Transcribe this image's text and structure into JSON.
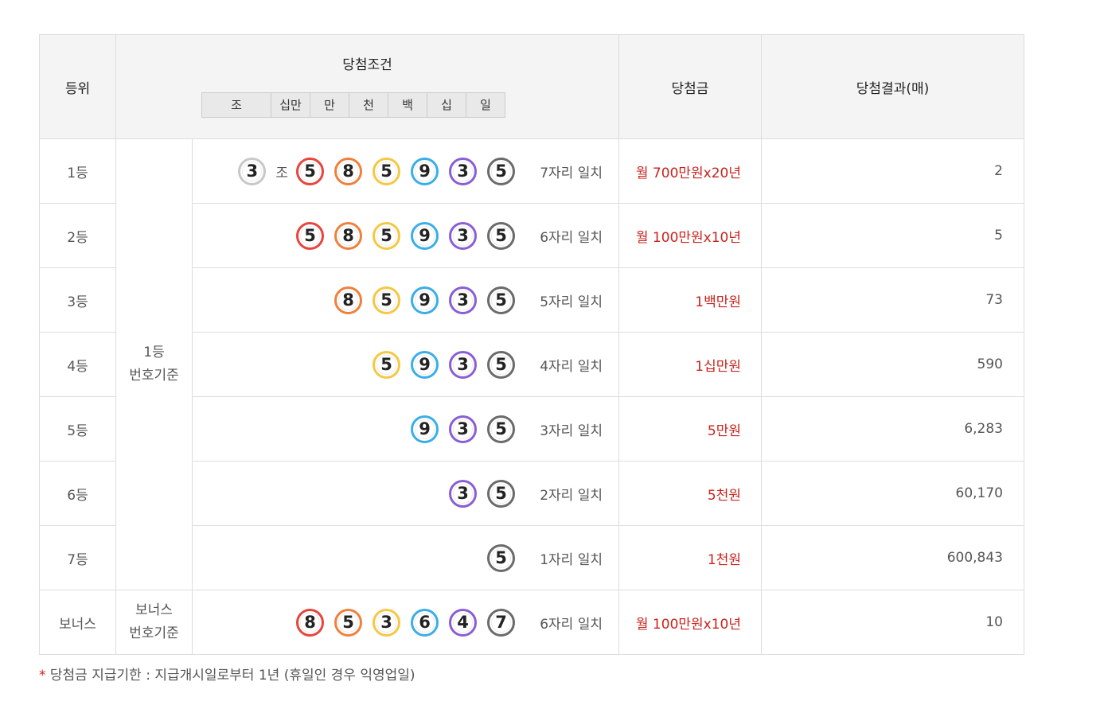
{
  "headers": {
    "rank": "등위",
    "condition": "당첨조건",
    "prize": "당첨금",
    "result": "당첨결과(매)"
  },
  "digit_headers": [
    "조",
    "십만",
    "만",
    "천",
    "백",
    "십",
    "일"
  ],
  "basis": {
    "main": [
      "1등",
      "번호기준"
    ],
    "bonus": [
      "보너스",
      "번호기준"
    ]
  },
  "jo_label": "조",
  "colors": {
    "ball_jo": "#c8c8c8",
    "ball_100k": "#e8453c",
    "ball_10k": "#f0803c",
    "ball_1k": "#f5c842",
    "ball_100": "#3aaee8",
    "ball_10": "#8a5ed6",
    "ball_1": "#6b6b6b",
    "prize_text": "#c9231d"
  },
  "rows": [
    {
      "rank": "1등",
      "jo": "3",
      "balls": [
        "5",
        "8",
        "5",
        "9",
        "3",
        "5"
      ],
      "match": "7자리 일치",
      "prize": "월 700만원x20년",
      "result": "2"
    },
    {
      "rank": "2등",
      "balls": [
        "5",
        "8",
        "5",
        "9",
        "3",
        "5"
      ],
      "match": "6자리 일치",
      "prize": "월 100만원x10년",
      "result": "5"
    },
    {
      "rank": "3등",
      "balls": [
        "8",
        "5",
        "9",
        "3",
        "5"
      ],
      "match": "5자리 일치",
      "prize": "1백만원",
      "result": "73"
    },
    {
      "rank": "4등",
      "balls": [
        "5",
        "9",
        "3",
        "5"
      ],
      "match": "4자리 일치",
      "prize": "1십만원",
      "result": "590"
    },
    {
      "rank": "5등",
      "balls": [
        "9",
        "3",
        "5"
      ],
      "match": "3자리 일치",
      "prize": "5만원",
      "result": "6,283"
    },
    {
      "rank": "6등",
      "balls": [
        "3",
        "5"
      ],
      "match": "2자리 일치",
      "prize": "5천원",
      "result": "60,170"
    },
    {
      "rank": "7등",
      "balls": [
        "5"
      ],
      "match": "1자리 일치",
      "prize": "1천원",
      "result": "600,843"
    },
    {
      "rank": "보너스",
      "balls": [
        "8",
        "5",
        "3",
        "6",
        "4",
        "7"
      ],
      "match": "6자리 일치",
      "prize": "월 100만원x10년",
      "result": "10"
    }
  ],
  "note": {
    "star": "*",
    "text": "당첨금 지급기한 : 지급개시일로부터 1년 (휴일인 경우 익영업일)"
  }
}
